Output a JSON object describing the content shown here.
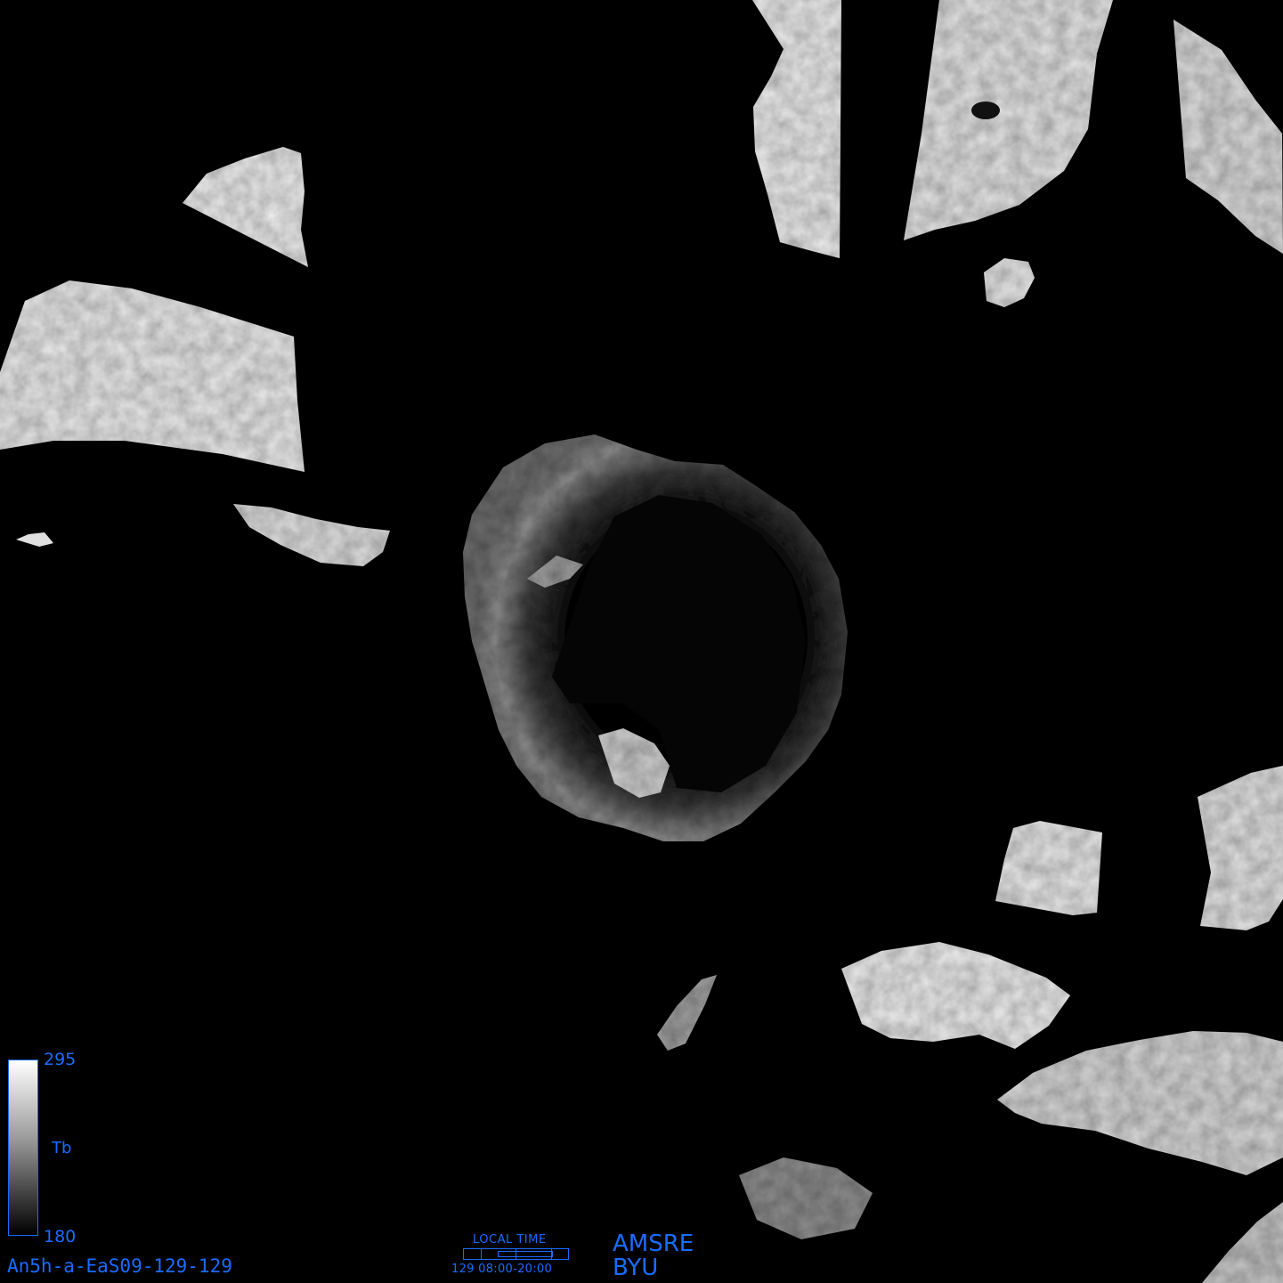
{
  "colorbar": {
    "max_label": "295",
    "min_label": "180",
    "variable_label": "Tb",
    "top_color": "#ffffff",
    "bottom_color": "#000000",
    "axis_color": "#1a6cff"
  },
  "image_id": "An5h-a-EaS09-129-129",
  "local_time": {
    "title": "LOCAL TIME",
    "range": "129 08:00-20:00"
  },
  "sensor": "AMSRE",
  "organization": "BYU"
}
